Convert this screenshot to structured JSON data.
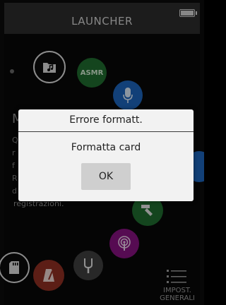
{
  "header": {
    "title": "LAUNCHER",
    "battery_level_percent": 100
  },
  "launcher": {
    "icons": [
      {
        "name": "folder-music-icon"
      },
      {
        "name": "asmr",
        "label": "ASMR",
        "color": "#1f6b2e"
      },
      {
        "name": "microphone-icon",
        "color": "#1c63b8"
      },
      {
        "name": "pen-icon",
        "color": "#1f6b2e"
      },
      {
        "name": "podcast-icon",
        "color": "#85127e"
      },
      {
        "name": "tuning-fork-icon",
        "color": "#3e3e3e"
      },
      {
        "name": "metronome-icon",
        "color": "#8e2e22"
      },
      {
        "name": "sd-card-icon"
      }
    ],
    "background_fragment_M": "M",
    "background_fragment_lines": [
      "Q",
      "r",
      "f",
      "R",
      "d"
    ],
    "background_text": "registrazioni.",
    "settings": {
      "line1": "IMPOST.",
      "line2": "GENERALI"
    }
  },
  "dialog": {
    "title": "Errore formatt.",
    "message": "Formatta card",
    "ok_label": "OK"
  }
}
